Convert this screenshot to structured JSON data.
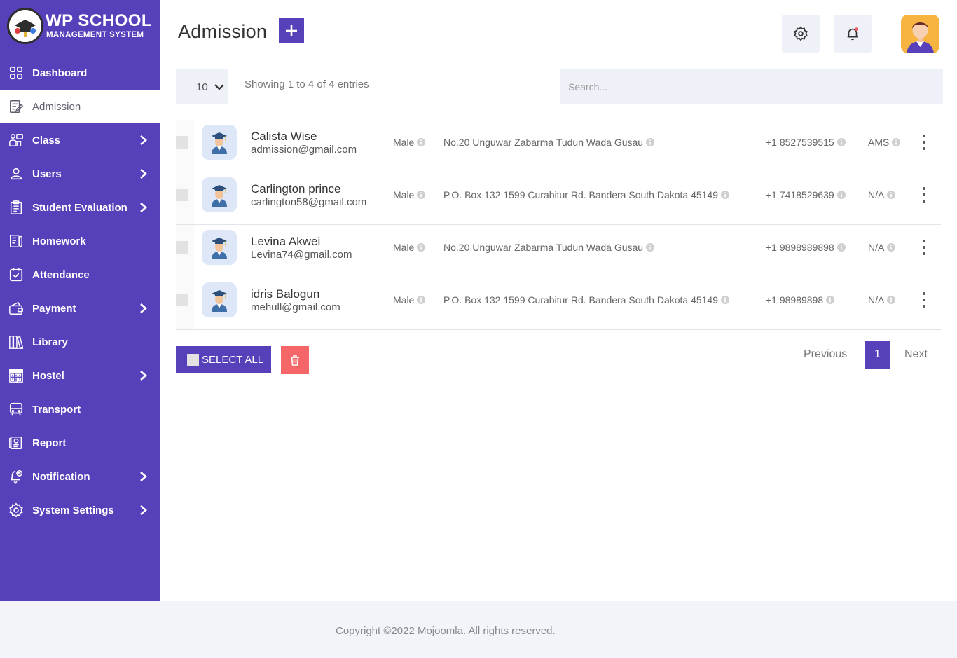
{
  "brand": {
    "title": "WP SCHOOL",
    "subtitle": "MANAGEMENT SYSTEM"
  },
  "sidebar": {
    "items": [
      {
        "label": "Dashboard",
        "icon": "grid-icon",
        "chevron": false,
        "active": false
      },
      {
        "label": "Admission",
        "icon": "form-icon",
        "chevron": false,
        "active": true
      },
      {
        "label": "Class",
        "icon": "class-icon",
        "chevron": true,
        "active": false
      },
      {
        "label": "Users",
        "icon": "user-icon",
        "chevron": true,
        "active": false
      },
      {
        "label": "Student Evaluation",
        "icon": "clipboard-icon",
        "chevron": true,
        "active": false
      },
      {
        "label": "Homework",
        "icon": "book-icon",
        "chevron": false,
        "active": false
      },
      {
        "label": "Attendance",
        "icon": "calendar-check-icon",
        "chevron": false,
        "active": false
      },
      {
        "label": "Payment",
        "icon": "wallet-icon",
        "chevron": true,
        "active": false
      },
      {
        "label": "Library",
        "icon": "library-icon",
        "chevron": false,
        "active": false
      },
      {
        "label": "Hostel",
        "icon": "hostel-icon",
        "chevron": true,
        "active": false
      },
      {
        "label": "Transport",
        "icon": "bus-icon",
        "chevron": false,
        "active": false
      },
      {
        "label": "Report",
        "icon": "report-icon",
        "chevron": false,
        "active": false
      },
      {
        "label": "Notification",
        "icon": "bell-pin-icon",
        "chevron": true,
        "active": false
      },
      {
        "label": "System Settings",
        "icon": "gear-icon",
        "chevron": true,
        "active": false
      }
    ]
  },
  "header": {
    "title": "Admission",
    "add_label": "+"
  },
  "toolbar": {
    "page_length": "10",
    "info": "Showing 1 to 4 of 4 entries",
    "search_placeholder": "Search..."
  },
  "rows": [
    {
      "name": "Calista Wise",
      "email": "admission@gmail.com",
      "gender": "Male",
      "address": "No.20 Unguwar Zabarma Tudun Wada Gusau",
      "phone": "+1 8527539515",
      "class": "AMS"
    },
    {
      "name": "Carlington prince",
      "email": "carlington58@gmail.com",
      "gender": "Male",
      "address": "P.O. Box 132 1599 Curabitur Rd. Bandera South Dakota 45149",
      "phone": "+1 7418529639",
      "class": "N/A"
    },
    {
      "name": "Levina Akwei",
      "email": "Levina74@gmail.com",
      "gender": "Male",
      "address": "No.20 Unguwar Zabarma Tudun Wada Gusau",
      "phone": "+1 9898989898",
      "class": "N/A"
    },
    {
      "name": "idris Balogun",
      "email": "mehull@gmail.com",
      "gender": "Male",
      "address": "P.O. Box 132 1599 Curabitur Rd. Bandera South Dakota 45149",
      "phone": "+1 98989898",
      "class": "N/A"
    }
  ],
  "actions": {
    "select_all": "SELECT ALL"
  },
  "pagination": {
    "previous": "Previous",
    "current": "1",
    "next": "Next"
  },
  "footer": {
    "copyright": "Copyright ©2022 Mojoomla. All rights reserved."
  },
  "colors": {
    "primary": "#5840bb",
    "danger": "#f46667",
    "surface": "#eef1f7"
  }
}
